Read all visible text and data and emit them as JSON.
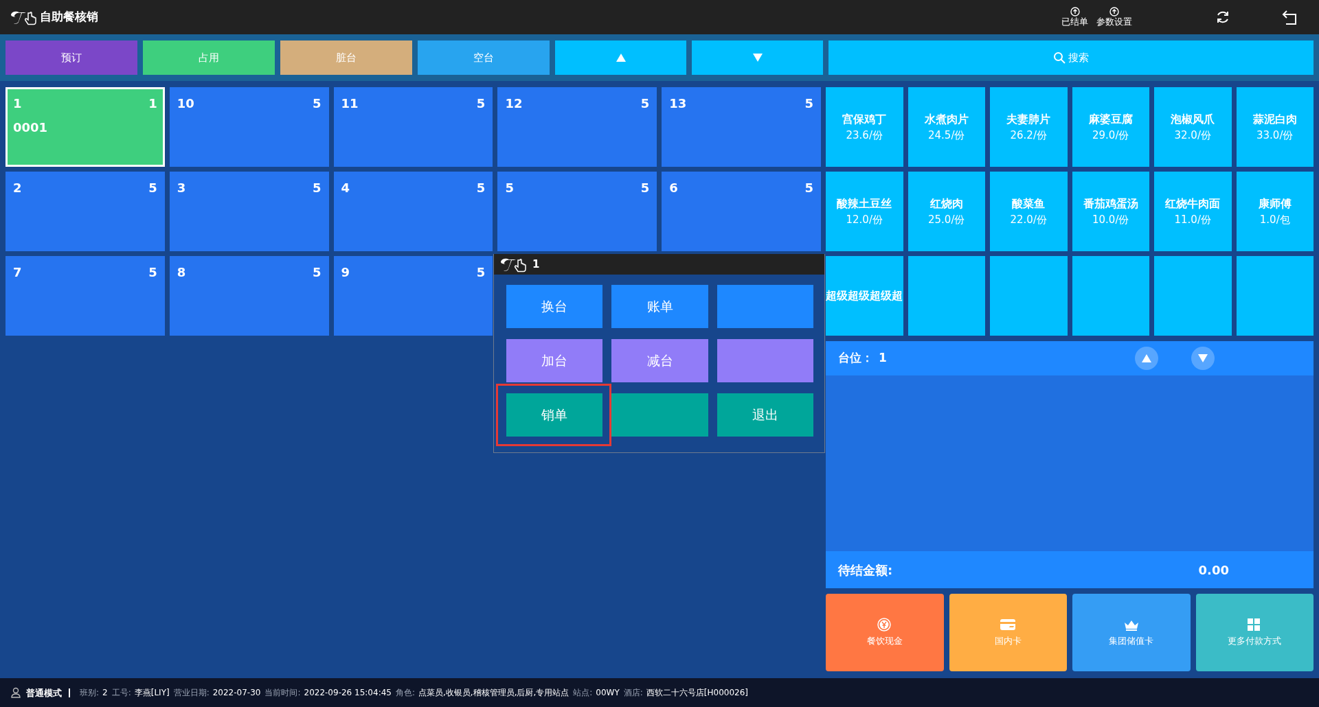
{
  "window": {
    "title": "自助餐核销"
  },
  "toolbar": [
    {
      "kind": "upload",
      "label": "已结单"
    },
    {
      "kind": "upload",
      "label": "参数设置"
    },
    {
      "kind": "refresh"
    },
    {
      "kind": "back"
    }
  ],
  "filters": [
    {
      "kind": "status",
      "label": "预订",
      "color": "#7b47c8"
    },
    {
      "kind": "status",
      "label": "占用",
      "color": "#3ecf7e"
    },
    {
      "kind": "status",
      "label": "脏台",
      "color": "#d4ae7c"
    },
    {
      "kind": "status",
      "label": "空台",
      "color": "#28a4ef"
    },
    {
      "kind": "page-up"
    },
    {
      "kind": "page-down"
    },
    {
      "kind": "search",
      "label": "搜索"
    }
  ],
  "tables": [
    {
      "number": "1",
      "seats": "1",
      "code": "0001",
      "occupied": true,
      "selected": true
    },
    {
      "number": "10",
      "seats": "5",
      "occupied": false,
      "selected": false
    },
    {
      "number": "11",
      "seats": "5",
      "occupied": false,
      "selected": false
    },
    {
      "number": "12",
      "seats": "5",
      "occupied": false,
      "selected": false
    },
    {
      "number": "13",
      "seats": "5",
      "occupied": false,
      "selected": false
    },
    {
      "number": "2",
      "seats": "5",
      "occupied": false,
      "selected": false
    },
    {
      "number": "3",
      "seats": "5",
      "occupied": false,
      "selected": false
    },
    {
      "number": "4",
      "seats": "5",
      "occupied": false,
      "selected": false
    },
    {
      "number": "5",
      "seats": "5",
      "occupied": false,
      "selected": false
    },
    {
      "number": "6",
      "seats": "5",
      "occupied": false,
      "selected": false
    },
    {
      "number": "7",
      "seats": "5",
      "occupied": false,
      "selected": false
    },
    {
      "number": "8",
      "seats": "5",
      "occupied": false,
      "selected": false
    },
    {
      "number": "9",
      "seats": "5",
      "occupied": false,
      "selected": false
    }
  ],
  "popup": {
    "title": "1",
    "rows": [
      {
        "color": "#1e88ff",
        "buttons": [
          {
            "kind": "action",
            "label": "换台",
            "highlighted": false
          },
          {
            "kind": "action",
            "label": "账单",
            "highlighted": false
          },
          {
            "kind": "blank"
          }
        ]
      },
      {
        "color": "#917cf8",
        "buttons": [
          {
            "kind": "action",
            "label": "加台",
            "highlighted": false
          },
          {
            "kind": "action",
            "label": "减台",
            "highlighted": false
          },
          {
            "kind": "blank"
          }
        ]
      },
      {
        "color": "#00a69a",
        "buttons": [
          {
            "kind": "action",
            "label": "销单",
            "highlighted": true
          },
          {
            "kind": "blank"
          },
          {
            "kind": "action",
            "label": "退出",
            "highlighted": false
          }
        ]
      }
    ]
  },
  "dishes": [
    {
      "name": "宫保鸡丁",
      "price": "23.6/份"
    },
    {
      "name": "水煮肉片",
      "price": "24.5/份"
    },
    {
      "name": "夫妻肺片",
      "price": "26.2/份"
    },
    {
      "name": "麻婆豆腐",
      "price": "29.0/份"
    },
    {
      "name": "泡椒风爪",
      "price": "32.0/份"
    },
    {
      "name": "蒜泥白肉",
      "price": "33.0/份"
    },
    {
      "name": "酸辣土豆丝",
      "price": "12.0/份"
    },
    {
      "name": "红烧肉",
      "price": "25.0/份"
    },
    {
      "name": "酸菜鱼",
      "price": "22.0/份"
    },
    {
      "name": "番茄鸡蛋汤",
      "price": "10.0/份"
    },
    {
      "name": "红烧牛肉面",
      "price": "11.0/份"
    },
    {
      "name": "康师傅",
      "price": "1.0/包"
    },
    {
      "name": "超级超级超级超"
    }
  ],
  "order": {
    "table_label": "台位：",
    "table_value": "1",
    "total_label": "待结金额:",
    "total_value": "0.00"
  },
  "payments": [
    {
      "kind": "cash",
      "label": "餐饮现金",
      "color": "#ff7743"
    },
    {
      "kind": "card",
      "label": "国内卡",
      "color": "#ffad44"
    },
    {
      "kind": "crown",
      "label": "集团储值卡",
      "color": "#359df4"
    },
    {
      "kind": "grid",
      "label": "更多付款方式",
      "color": "#3bbcc7"
    }
  ],
  "status_bar": {
    "mode": "普通模式",
    "fields": [
      {
        "label": "班别:",
        "value": "2"
      },
      {
        "label": "工号:",
        "value": "李燕[LIY]"
      },
      {
        "label": "营业日期:",
        "value": "2022-07-30"
      },
      {
        "label": "当前时间:",
        "value": "2022-09-26 15:04:45"
      },
      {
        "label": "角色:",
        "value": "点菜员,收银员,稽核管理员,后厨,专用站点"
      },
      {
        "label": "站点:",
        "value": "00WY"
      },
      {
        "label": "酒店:",
        "value": "西软二十六号店[H000026]"
      }
    ]
  }
}
